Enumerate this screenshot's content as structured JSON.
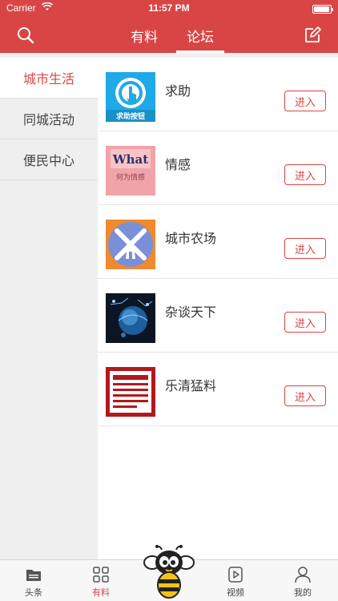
{
  "status_bar": {
    "carrier": "Carrier",
    "time": "11:57 PM"
  },
  "header": {
    "tabs": [
      {
        "label": "有料"
      },
      {
        "label": "论坛",
        "active": true
      }
    ],
    "accent_color": "#d94545"
  },
  "sidebar": {
    "items": [
      {
        "label": "城市生活",
        "active": true
      },
      {
        "label": "同城活动"
      },
      {
        "label": "便民中心"
      }
    ]
  },
  "forums": [
    {
      "title": "求助",
      "thumb_text": "求助按钮",
      "button": "进入"
    },
    {
      "title": "情感",
      "thumb_text": "What",
      "thumb_subtext": "何为情感",
      "button": "进入"
    },
    {
      "title": "城市农场",
      "button": "进入"
    },
    {
      "title": "杂谈天下",
      "button": "进入"
    },
    {
      "title": "乐清猛料",
      "button": "进入"
    }
  ],
  "tabbar": {
    "items": [
      {
        "label": "头条",
        "icon": "folder-icon"
      },
      {
        "label": "有料",
        "icon": "grid-icon",
        "active": true
      },
      {
        "label": "",
        "icon": "bee-mascot-icon"
      },
      {
        "label": "视频",
        "icon": "play-icon"
      },
      {
        "label": "我的",
        "icon": "person-icon"
      }
    ]
  }
}
